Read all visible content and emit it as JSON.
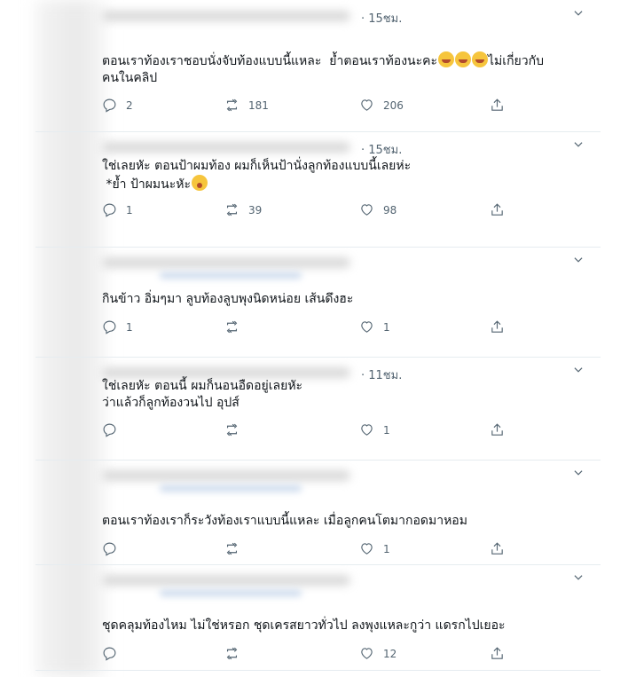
{
  "tweets": [
    {
      "time": "· 15ชม.",
      "text": "ตอนเราท้องเราชอบนั่งจับท้องแบบนี้แหละ  ย้ำตอนเราท้องนะคะ",
      "text_after": "ไม่เกี่ยวกับ\nคนในคลิป",
      "emojis": "😂😂😂",
      "reply": "2",
      "retweet": "181",
      "like": "206"
    },
    {
      "time": "· 15ชม.",
      "text": "ใช่เลยหัะ ตอนป้าผมท้อง ผมก็เห็นป้านั่งลูกท้องแบบนี้เลยห่ะ\n *ย้ำ ป้าผมนะหัะ",
      "emojis": "😲",
      "reply": "1",
      "retweet": "39",
      "like": "98"
    },
    {
      "time": "",
      "text": "กินข้าว อิ่มๆมา ลูบท้องลูบพุงนิดหน่อย เส้นดึงฮะ",
      "reply": "1",
      "retweet": "",
      "like": "1"
    },
    {
      "time": "· 11ชม.",
      "text": "ใช่เลยหัะ ตอนนี้ ผมก็นอนอืดอยู่เลยหัะ\nว่าแล้วก็ลูกท้องวนไป อุปส์",
      "reply": "",
      "retweet": "",
      "like": "1"
    },
    {
      "time": "",
      "text": "ตอนเราท้องเราก็ระวังท้องเราแบบนี้แหละ เมื่อลูกคนโตมากอดมาหอม",
      "reply": "",
      "retweet": "",
      "like": "1"
    },
    {
      "time": "",
      "text": "ชุดคลุมท้องไหม ไม่ใช่หรอก ชุดเครสยาวทั่วไป ลงพุงแหละกูว่า แดรกไปเยอะ",
      "reply": "",
      "retweet": "",
      "like": "12"
    }
  ]
}
